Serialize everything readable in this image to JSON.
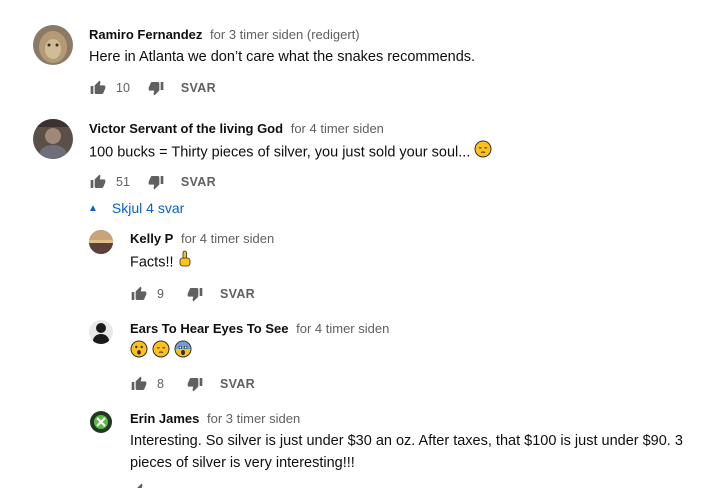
{
  "comments": [
    {
      "author": "Ramiro Fernandez",
      "time": "for 3 timer siden (redigert)",
      "text": "Here in Atlanta we don’t care what the snakes recommends.",
      "likes": "10",
      "reply": "SVAR"
    },
    {
      "author": "Victor Servant of the living God",
      "time": "for 4 timer siden",
      "text": "100 bucks = Thirty pieces of silver, you just sold your soul...",
      "likes": "51",
      "reply": "SVAR"
    }
  ],
  "toggle_replies": "Skjul 4 svar",
  "replies": [
    {
      "author": "Kelly P",
      "time": "for 4 timer siden",
      "text": "Facts!!",
      "likes": "9",
      "reply": "SVAR"
    },
    {
      "author": "Ears To Hear Eyes To See",
      "time": "for 4 timer siden",
      "text": "",
      "likes": "8",
      "reply": "SVAR"
    },
    {
      "author": "Erin James",
      "time": "for 3 timer siden",
      "text_line1": "Interesting. So silver is just under $30 an oz. After taxes, that $100 is just under $90. 3",
      "text_line2": "pieces of silver is very interesting!!!"
    }
  ],
  "colors": {
    "link": "#065fd4",
    "secondary": "#606060"
  }
}
